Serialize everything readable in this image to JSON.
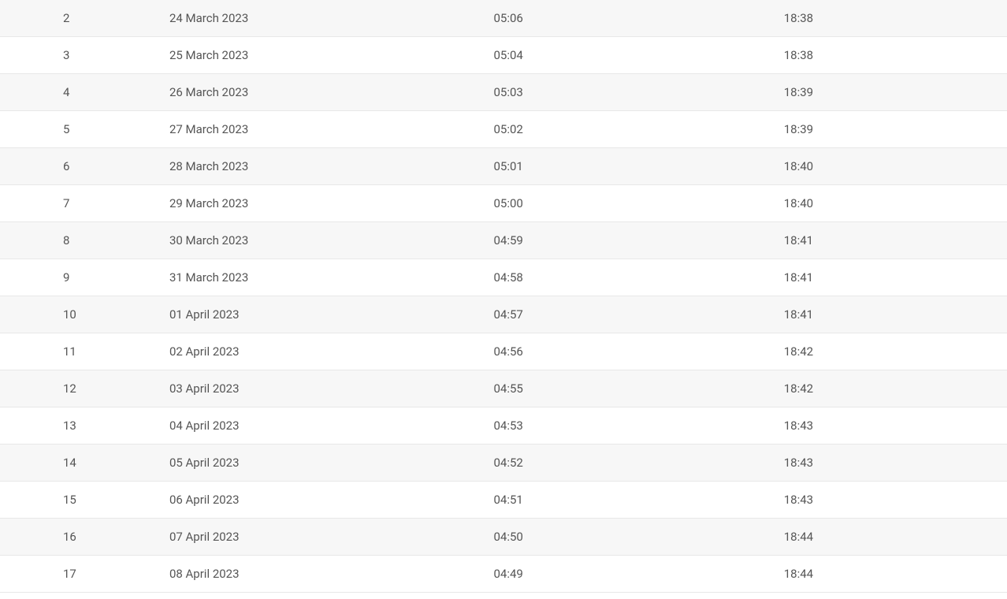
{
  "table": {
    "rows": [
      {
        "id": 2,
        "date": "24 March 2023",
        "sunrise": "05:06",
        "sunset": "18:38"
      },
      {
        "id": 3,
        "date": "25 March 2023",
        "sunrise": "05:04",
        "sunset": "18:38"
      },
      {
        "id": 4,
        "date": "26 March 2023",
        "sunrise": "05:03",
        "sunset": "18:39"
      },
      {
        "id": 5,
        "date": "27 March 2023",
        "sunrise": "05:02",
        "sunset": "18:39"
      },
      {
        "id": 6,
        "date": "28 March 2023",
        "sunrise": "05:01",
        "sunset": "18:40"
      },
      {
        "id": 7,
        "date": "29 March 2023",
        "sunrise": "05:00",
        "sunset": "18:40"
      },
      {
        "id": 8,
        "date": "30 March 2023",
        "sunrise": "04:59",
        "sunset": "18:41"
      },
      {
        "id": 9,
        "date": "31 March 2023",
        "sunrise": "04:58",
        "sunset": "18:41"
      },
      {
        "id": 10,
        "date": "01 April 2023",
        "sunrise": "04:57",
        "sunset": "18:41"
      },
      {
        "id": 11,
        "date": "02 April 2023",
        "sunrise": "04:56",
        "sunset": "18:42"
      },
      {
        "id": 12,
        "date": "03 April 2023",
        "sunrise": "04:55",
        "sunset": "18:42"
      },
      {
        "id": 13,
        "date": "04 April 2023",
        "sunrise": "04:53",
        "sunset": "18:43"
      },
      {
        "id": 14,
        "date": "05 April 2023",
        "sunrise": "04:52",
        "sunset": "18:43"
      },
      {
        "id": 15,
        "date": "06 April 2023",
        "sunrise": "04:51",
        "sunset": "18:43"
      },
      {
        "id": 16,
        "date": "07 April 2023",
        "sunrise": "04:50",
        "sunset": "18:44"
      },
      {
        "id": 17,
        "date": "08 April 2023",
        "sunrise": "04:49",
        "sunset": "18:44"
      }
    ]
  }
}
